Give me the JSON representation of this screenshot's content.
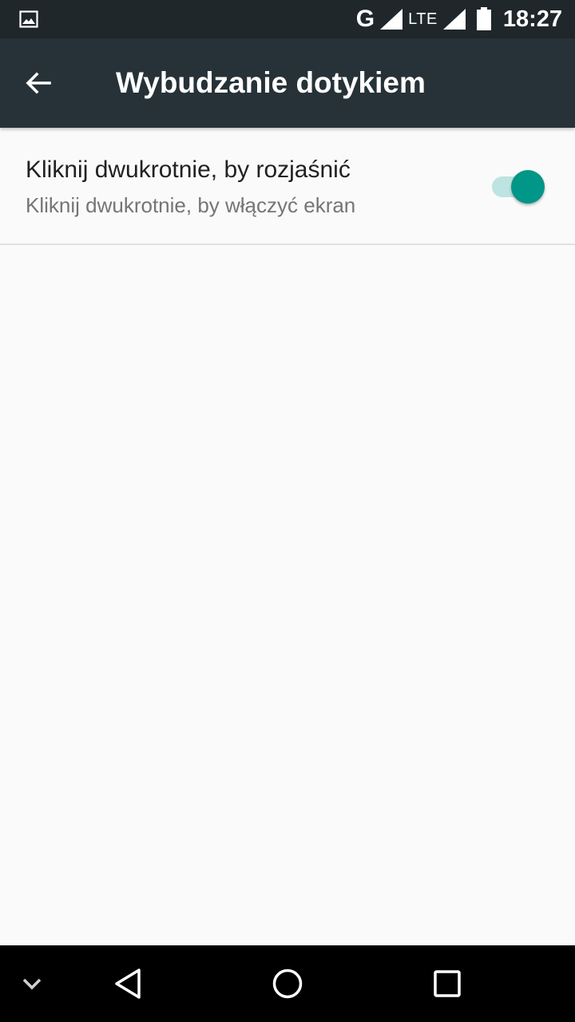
{
  "status_bar": {
    "left_icon": "image-notification-icon",
    "network_type": "G",
    "lte_label": "LTE",
    "signal_icon": "signal-icon",
    "battery_icon": "battery-icon",
    "time": "18:27"
  },
  "app_bar": {
    "back_icon": "arrow-back-icon",
    "title": "Wybudzanie dotykiem"
  },
  "settings": [
    {
      "title": "Kliknij dwukrotnie, by rozjaśnić",
      "summary": "Kliknij dwukrotnie, by włączyć ekran",
      "enabled": true
    }
  ],
  "nav_bar": {
    "icons": [
      "chevron-down-icon",
      "back-triangle-icon",
      "home-circle-icon",
      "recents-square-icon"
    ]
  },
  "colors": {
    "status_bar": "#1f272b",
    "app_bar": "#263238",
    "accent": "#009688",
    "background": "#fafafa"
  }
}
